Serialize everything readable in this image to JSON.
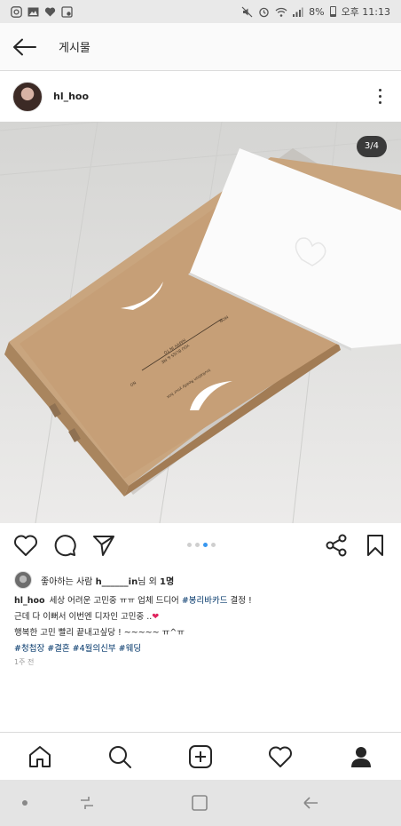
{
  "status_bar": {
    "battery": "8%",
    "time": "오후 11:13"
  },
  "header": {
    "title": "게시물"
  },
  "post": {
    "username": "hl_hoo",
    "image_counter": "3/4",
    "photo_box_text": [
      "HAPPY IN TO",
      "YOU BLISS & ME",
      "MON",
      "NO",
      "Invitation Ready your box"
    ],
    "carousel": {
      "current": 3,
      "total": 4
    },
    "likes": {
      "prefix": "좋아하는 사람 ",
      "user": "h______in",
      "middle": "님 외 ",
      "count": "1명"
    },
    "caption": {
      "user": "hl_hoo",
      "line1_text": "세상 어려운 고민중 ㅠㅠ 업체 드디어 ",
      "line1_tag": "#봉리바카드",
      "line1_tail": " 결정 !",
      "line2": "근데 다 이뻐서 이번엔 디자인 고민중 ..",
      "line2_emoji": "❤",
      "line3": "행복한 고민 빨리 끝내고싶당 ! ~~~~~ ㅠ^ㅠ",
      "line4_tags": "#청첩장 #결혼 #4월의신부 #웨딩"
    },
    "time": "1주 전"
  },
  "icons": {
    "back": "arrow-left-icon",
    "more": "more-vertical-icon",
    "like": "heart-icon",
    "comment": "comment-icon",
    "share": "send-icon",
    "share_alt": "share-icon",
    "save": "bookmark-icon"
  },
  "colors": {
    "tag": "#003569",
    "dot_active": "#3897f0",
    "heart": "#e0245e"
  }
}
